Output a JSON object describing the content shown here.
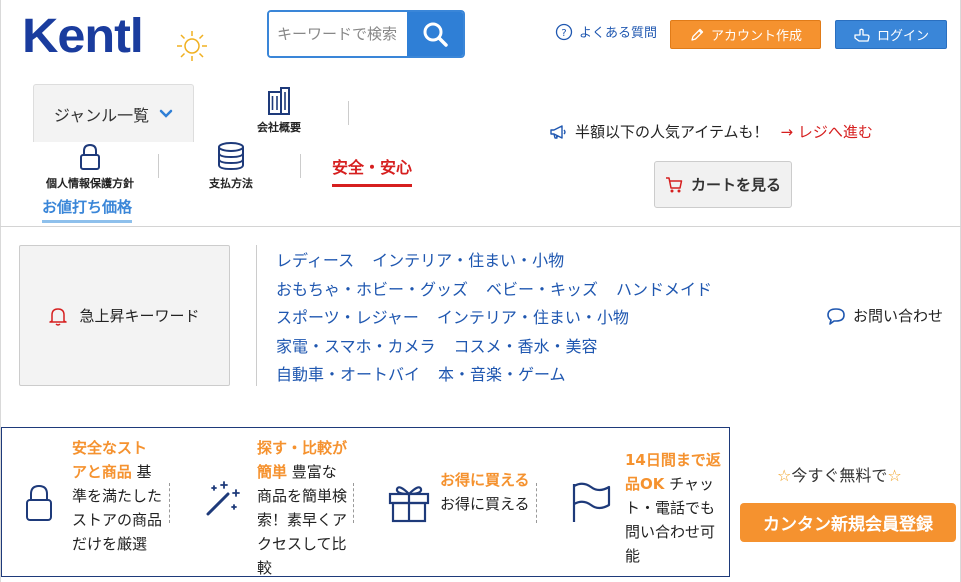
{
  "header": {
    "logo_text": "Kentl",
    "search_placeholder": "キーワードで検索",
    "faq_label": "よくある質問",
    "create_account_label": "アカウント作成",
    "login_label": "ログイン"
  },
  "nav": {
    "genre_label": "ジャンル一覧",
    "company_label": "会社概要",
    "privacy_label": "個人情報保護方針",
    "payment_label": "支払方法",
    "safety_label": "安全・安心",
    "discount_label": "お値打ち価格",
    "promo_text": "半額以下の人気アイテムも！",
    "checkout_link": "→ レジへ進む",
    "cart_label": "カートを見る"
  },
  "keywords": {
    "title": "急上昇キーワード",
    "rows": [
      [
        "レディース",
        "インテリア・住まい・小物"
      ],
      [
        "おもちゃ・ホビー・グッズ",
        "ベビー・キッズ",
        "ハンドメイド"
      ],
      [
        "スポーツ・レジャー",
        "インテリア・住まい・小物"
      ],
      [
        "家電・スマホ・カメラ",
        "コスメ・香水・美容"
      ],
      [
        "自動車・オートバイ",
        "本・音楽・ゲーム"
      ]
    ],
    "contact_label": "お問い合わせ"
  },
  "features": [
    {
      "icon": "lock-icon",
      "highlight": "安全なストアと商品",
      "body": "基準を満たしたストアの商品だけを厳選"
    },
    {
      "icon": "magic-wand-icon",
      "highlight": "探す・比較が簡単",
      "body": "豊富な商品を簡単検索！素早くアクセスして比較"
    },
    {
      "icon": "gift-icon",
      "highlight": "お得に買える",
      "body": "お得に買える"
    },
    {
      "icon": "flag-icon",
      "highlight": "14日間まで返品OK",
      "body": "チャット・電話でも問い合わせ可能"
    }
  ],
  "signup": {
    "free_text": "今すぐ無料で",
    "star": "☆",
    "button_label": "カンタン新規会員登録"
  },
  "colors": {
    "brand_blue": "#1a3c9e",
    "accent_orange": "#f5922f",
    "link_blue": "#1f57b0",
    "alert_red": "#d61f1f"
  }
}
